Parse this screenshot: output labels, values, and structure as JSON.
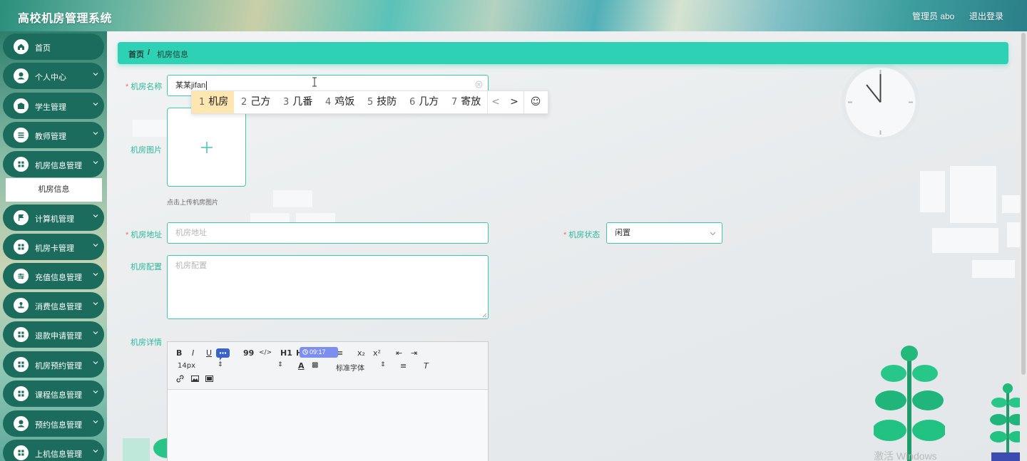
{
  "app": {
    "title": "高校机房管理系统",
    "user_label": "管理员 abo",
    "logout_label": "退出登录"
  },
  "sidebar": {
    "items": [
      {
        "label": "首页",
        "icon": "home-icon",
        "has_children": false
      },
      {
        "label": "个人中心",
        "icon": "user-icon",
        "has_children": true
      },
      {
        "label": "学生管理",
        "icon": "student-icon",
        "has_children": true
      },
      {
        "label": "教师管理",
        "icon": "list-icon",
        "has_children": true
      },
      {
        "label": "机房信息管理",
        "icon": "grid-icon",
        "has_children": true
      },
      {
        "label": "计算机管理",
        "icon": "flag-icon",
        "has_children": true
      },
      {
        "label": "机房卡管理",
        "icon": "grid-icon",
        "has_children": true
      },
      {
        "label": "充值信息管理",
        "icon": "sliders-icon",
        "has_children": true
      },
      {
        "label": "消费信息管理",
        "icon": "stamp-icon",
        "has_children": true
      },
      {
        "label": "退款申请管理",
        "icon": "grid-icon",
        "has_children": true
      },
      {
        "label": "机房预约管理",
        "icon": "grid-icon",
        "has_children": true
      },
      {
        "label": "课程信息管理",
        "icon": "grid-icon",
        "has_children": true
      },
      {
        "label": "预约信息管理",
        "icon": "user-icon",
        "has_children": true
      },
      {
        "label": "上机信息管理",
        "icon": "grid-icon",
        "has_children": true
      }
    ],
    "active_submenu": "机房信息"
  },
  "breadcrumb": {
    "home": "首页",
    "separator": "/",
    "current": "机房信息"
  },
  "form": {
    "name": {
      "label": "机房名称",
      "required": true,
      "value": "某某jifan"
    },
    "image": {
      "label": "机房图片",
      "hint": "点击上传机房图片"
    },
    "address": {
      "label": "机房地址",
      "required": true,
      "placeholder": "机房地址"
    },
    "status": {
      "label": "机房状态",
      "required": true,
      "value": "闲置"
    },
    "config": {
      "label": "机房配置",
      "placeholder": "机房配置"
    },
    "detail": {
      "label": "机房详情"
    }
  },
  "ime": {
    "candidates": [
      {
        "num": "1",
        "text": "机房",
        "selected": true
      },
      {
        "num": "2",
        "text": "己方",
        "selected": false
      },
      {
        "num": "3",
        "text": "几番",
        "selected": false
      },
      {
        "num": "4",
        "text": "鸡饭",
        "selected": false
      },
      {
        "num": "5",
        "text": "技防",
        "selected": false
      },
      {
        "num": "6",
        "text": "几方",
        "selected": false
      },
      {
        "num": "7",
        "text": "寄放",
        "selected": false
      }
    ],
    "prev": "<",
    "next": ">",
    "emoji": "☺"
  },
  "editor": {
    "toolbar_row1": [
      "B",
      "I",
      "U",
      "S",
      "99",
      "</>",
      "H1",
      "H2",
      "≡",
      "≡",
      "x₂",
      "x²",
      "⇤",
      "⇥"
    ],
    "font_size": "14px",
    "font_family": "标准字体",
    "time_chip": "09:17"
  },
  "watermark": "激活 Windows",
  "colors": {
    "accent": "#2fd1b5",
    "sidebar_item": "#1c6c5e",
    "required": "#f56c6c",
    "label": "#2fb99c"
  }
}
